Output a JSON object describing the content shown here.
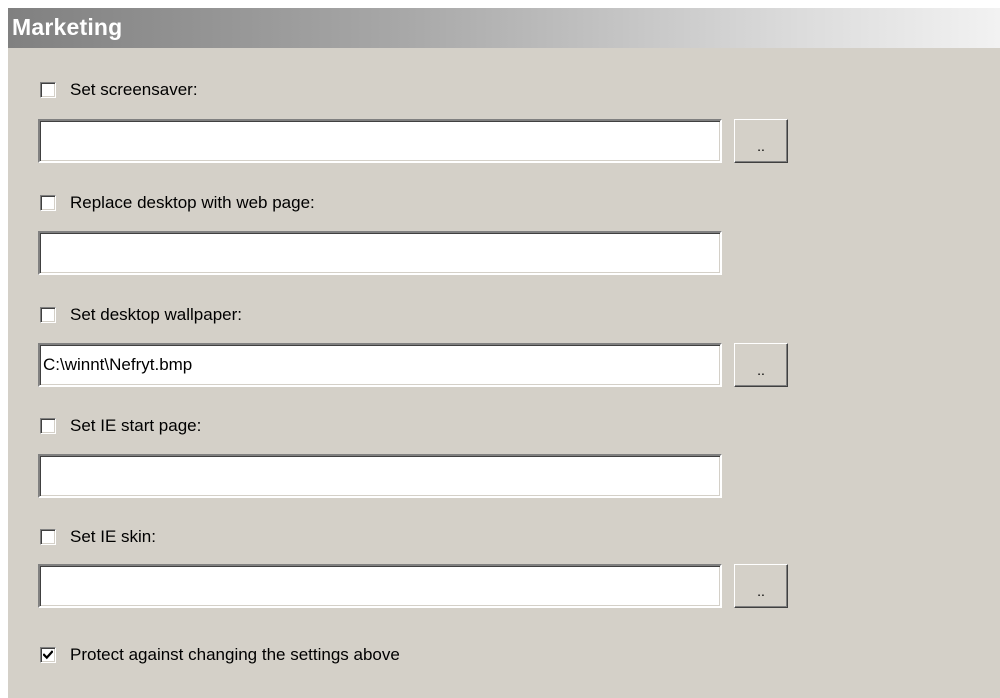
{
  "header": {
    "title": "Marketing"
  },
  "screensaver": {
    "label": "Set screensaver:",
    "checked": false,
    "value": "",
    "browse_label": ".."
  },
  "webpage": {
    "label": "Replace desktop with web page:",
    "checked": false,
    "value": ""
  },
  "wallpaper": {
    "label": "Set desktop wallpaper:",
    "checked": false,
    "value": "C:\\winnt\\Nefryt.bmp",
    "browse_label": ".."
  },
  "ie_start": {
    "label": "Set IE start page:",
    "checked": false,
    "value": ""
  },
  "ie_skin": {
    "label": "Set IE skin:",
    "checked": false,
    "value": "",
    "browse_label": ".."
  },
  "protect": {
    "label": "Protect against changing the settings above",
    "checked": true
  },
  "icons": {
    "check": "checkmark-icon"
  }
}
